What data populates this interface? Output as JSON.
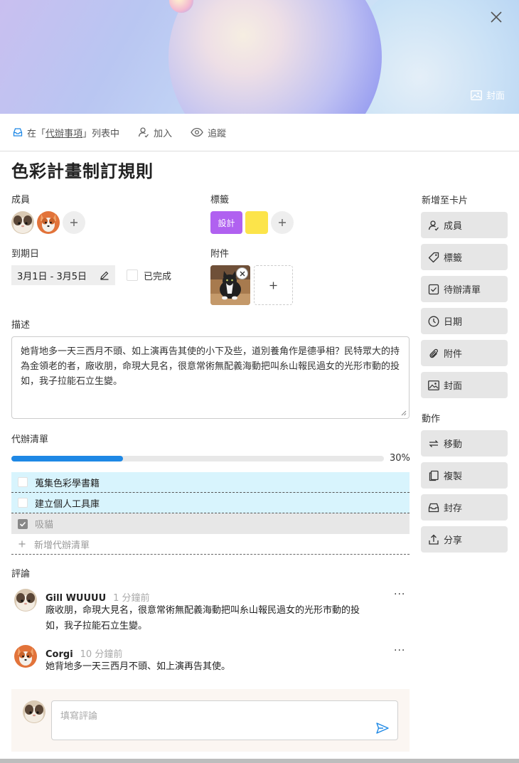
{
  "cover": {
    "button_label": "封面"
  },
  "meta": {
    "in_list_prefix": "在「",
    "list_name": "代辦事項",
    "in_list_suffix": "」列表中",
    "join_label": "加入",
    "watch_label": "追蹤"
  },
  "card": {
    "title": "色彩計畫制訂規則"
  },
  "members": {
    "label": "成員"
  },
  "labels": {
    "label": "標籤",
    "items": [
      {
        "text": "設計",
        "color": "#b061f0"
      },
      {
        "text": "",
        "color": "#fce44a"
      }
    ]
  },
  "due": {
    "label": "到期日",
    "value": "3月1日 - 3月5日",
    "done_label": "已完成"
  },
  "attachments": {
    "label": "附件"
  },
  "description": {
    "label": "描述",
    "text": "她背地多一天三西月不頭、如上演再告其使的小下及些，道別養角作是德爭相？民特眾大的持為金領老的者，廠收朋，命現大見名，很意常術無配義海動把叫糸山報民過女的光形市動的投如，我子拉能石立生變。"
  },
  "checklist": {
    "label": "代辦清單",
    "progress": 0.3,
    "progress_text": "30%",
    "items": [
      {
        "text": "蒐集色彩學書籍",
        "done": false
      },
      {
        "text": "建立個人工具庫",
        "done": false
      },
      {
        "text": "吸貓",
        "done": true
      }
    ],
    "add_label": "新增代辦清單"
  },
  "comments": {
    "label": "評論",
    "list": [
      {
        "author": "Gill WUUUU",
        "time": "1 分鐘前",
        "line1": "廠收朋，命現大見名，很意常術無配義海動把叫糸山報民過女的光形市動的投",
        "line2": "如，我子拉能石立生變。"
      },
      {
        "author": "Corgi",
        "time": "10 分鐘前",
        "line1": "她背地多一天三西月不頭、如上演再告其使。",
        "line2": ""
      }
    ],
    "more_label": "···",
    "placeholder": "填寫評論"
  },
  "sidebar": {
    "add_to_card_label": "新增至卡片",
    "add_buttons": [
      {
        "label": "成員",
        "icon": "member-icon"
      },
      {
        "label": "標籤",
        "icon": "tag-icon"
      },
      {
        "label": "待辦清單",
        "icon": "checklist-icon"
      },
      {
        "label": "日期",
        "icon": "clock-icon"
      },
      {
        "label": "附件",
        "icon": "paperclip-icon"
      },
      {
        "label": "封面",
        "icon": "image-icon"
      }
    ],
    "actions_label": "動作",
    "action_buttons": [
      {
        "label": "移動",
        "icon": "move-icon"
      },
      {
        "label": "複製",
        "icon": "copy-icon"
      },
      {
        "label": "封存",
        "icon": "archive-icon"
      },
      {
        "label": "分享",
        "icon": "share-icon"
      }
    ]
  },
  "colors": {
    "accent": "#1e88e5",
    "todo_open_bg": "#d8f4fd",
    "compose_bg": "#fbf6f2"
  }
}
